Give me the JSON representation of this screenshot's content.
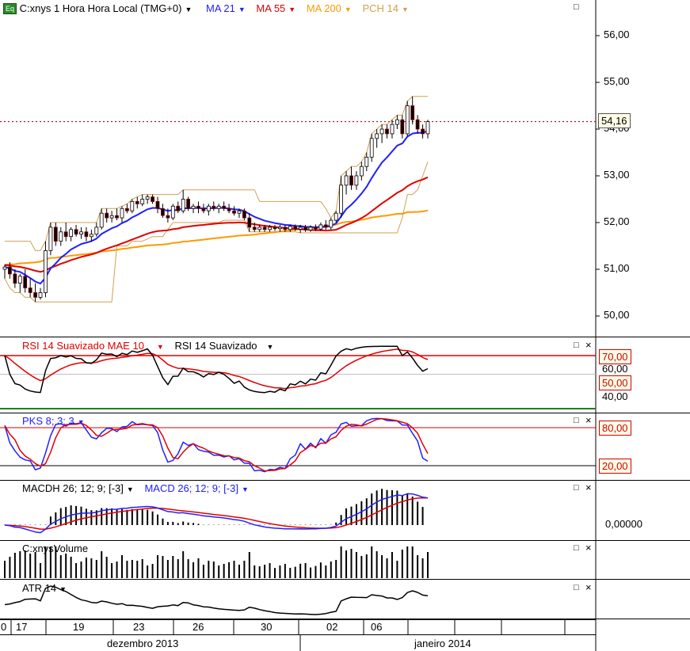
{
  "main": {
    "eq_icon": "Eq",
    "symbol": "C:xnys 1 Hora Hora Local (TMG+0)",
    "indicators": [
      {
        "label": "MA 21",
        "color": "#2020ff"
      },
      {
        "label": "MA 55",
        "color": "#e00000"
      },
      {
        "label": "MA 200",
        "color": "#ff9900"
      },
      {
        "label": "PCH 14",
        "color": "#d0a050"
      }
    ],
    "price_axis": [
      "56,00",
      "55,00",
      "54,00",
      "53,00",
      "52,00",
      "51,00",
      "50,00"
    ],
    "last_price": "54,16",
    "ohlc": [
      [
        51.0,
        51.1,
        50.8,
        51.05
      ],
      [
        51.05,
        51.15,
        50.8,
        50.9
      ],
      [
        50.9,
        51.0,
        50.6,
        50.7
      ],
      [
        50.7,
        50.9,
        50.5,
        50.85
      ],
      [
        50.85,
        51.0,
        50.5,
        50.6
      ],
      [
        50.6,
        50.8,
        50.4,
        50.5
      ],
      [
        50.5,
        50.7,
        50.3,
        50.4
      ],
      [
        50.4,
        50.6,
        50.35,
        50.5
      ],
      [
        50.5,
        51.6,
        50.4,
        51.4
      ],
      [
        51.4,
        52.0,
        51.3,
        51.9
      ],
      [
        51.9,
        52.0,
        51.5,
        51.6
      ],
      [
        51.6,
        51.9,
        51.5,
        51.8
      ],
      [
        51.8,
        52.0,
        51.6,
        51.7
      ],
      [
        51.7,
        51.9,
        51.6,
        51.85
      ],
      [
        51.85,
        51.95,
        51.7,
        51.75
      ],
      [
        51.75,
        51.9,
        51.65,
        51.8
      ],
      [
        51.8,
        51.9,
        51.6,
        51.7
      ],
      [
        51.7,
        51.85,
        51.6,
        51.75
      ],
      [
        51.75,
        52.0,
        51.7,
        51.9
      ],
      [
        51.9,
        52.3,
        51.85,
        52.2
      ],
      [
        52.2,
        52.3,
        52.0,
        52.1
      ],
      [
        52.1,
        52.25,
        52.0,
        52.15
      ],
      [
        52.15,
        52.3,
        52.05,
        52.1
      ],
      [
        52.1,
        52.35,
        52.0,
        52.3
      ],
      [
        52.3,
        52.4,
        52.2,
        52.25
      ],
      [
        52.25,
        52.5,
        52.2,
        52.45
      ],
      [
        52.45,
        52.55,
        52.3,
        52.4
      ],
      [
        52.4,
        52.6,
        52.35,
        52.5
      ],
      [
        52.5,
        52.6,
        52.4,
        52.55
      ],
      [
        52.55,
        52.6,
        52.4,
        52.45
      ],
      [
        52.45,
        52.55,
        52.2,
        52.3
      ],
      [
        52.3,
        52.4,
        52.1,
        52.15
      ],
      [
        52.15,
        52.3,
        52.0,
        52.1
      ],
      [
        52.1,
        52.4,
        52.05,
        52.35
      ],
      [
        52.35,
        52.45,
        52.2,
        52.25
      ],
      [
        52.25,
        52.7,
        52.2,
        52.5
      ],
      [
        52.5,
        52.55,
        52.25,
        52.3
      ],
      [
        52.3,
        52.4,
        52.2,
        52.35
      ],
      [
        52.35,
        52.45,
        52.2,
        52.3
      ],
      [
        52.3,
        52.4,
        52.2,
        52.25
      ],
      [
        52.25,
        52.4,
        52.15,
        52.35
      ],
      [
        52.35,
        52.45,
        52.25,
        52.3
      ],
      [
        52.3,
        52.4,
        52.2,
        52.35
      ],
      [
        52.35,
        52.45,
        52.25,
        52.3
      ],
      [
        52.3,
        52.4,
        52.2,
        52.25
      ],
      [
        52.25,
        52.35,
        52.15,
        52.2
      ],
      [
        52.2,
        52.3,
        52.1,
        52.25
      ],
      [
        52.25,
        52.3,
        52.05,
        52.1
      ],
      [
        52.1,
        52.2,
        51.8,
        51.9
      ],
      [
        51.9,
        52.0,
        51.8,
        51.85
      ],
      [
        51.85,
        51.95,
        51.8,
        51.9
      ],
      [
        51.9,
        51.95,
        51.8,
        51.85
      ],
      [
        51.85,
        51.95,
        51.8,
        51.9
      ],
      [
        51.9,
        51.95,
        51.82,
        51.87
      ],
      [
        51.87,
        51.95,
        51.8,
        51.9
      ],
      [
        51.9,
        51.95,
        51.8,
        51.85
      ],
      [
        51.85,
        51.95,
        51.8,
        51.92
      ],
      [
        51.92,
        51.96,
        51.82,
        51.86
      ],
      [
        51.86,
        51.95,
        51.78,
        51.9
      ],
      [
        51.9,
        51.95,
        51.8,
        51.84
      ],
      [
        51.84,
        51.94,
        51.8,
        51.9
      ],
      [
        51.9,
        51.96,
        51.82,
        51.86
      ],
      [
        51.86,
        52.0,
        51.82,
        51.95
      ],
      [
        51.95,
        52.05,
        51.85,
        51.9
      ],
      [
        51.9,
        52.1,
        51.85,
        52.05
      ],
      [
        52.05,
        52.25,
        52.0,
        52.2
      ],
      [
        52.2,
        53.0,
        52.1,
        52.8
      ],
      [
        52.8,
        53.1,
        52.6,
        53.0
      ],
      [
        53.0,
        53.2,
        52.7,
        52.8
      ],
      [
        52.8,
        53.1,
        52.7,
        53.0
      ],
      [
        53.0,
        53.3,
        52.9,
        53.2
      ],
      [
        53.2,
        53.5,
        53.1,
        53.4
      ],
      [
        53.4,
        53.9,
        53.3,
        53.8
      ],
      [
        53.8,
        54.0,
        53.6,
        53.9
      ],
      [
        53.9,
        54.1,
        53.7,
        54.0
      ],
      [
        54.0,
        54.1,
        53.8,
        53.9
      ],
      [
        53.9,
        54.2,
        53.8,
        54.1
      ],
      [
        54.1,
        54.3,
        54.0,
        54.2
      ],
      [
        54.2,
        54.3,
        53.8,
        53.9
      ],
      [
        53.9,
        54.6,
        53.85,
        54.5
      ],
      [
        54.5,
        54.7,
        54.1,
        54.2
      ],
      [
        54.2,
        54.3,
        53.9,
        54.0
      ],
      [
        54.0,
        54.1,
        53.8,
        53.9
      ],
      [
        53.9,
        54.2,
        53.8,
        54.16
      ]
    ],
    "pch_upper": [
      51.6,
      51.6,
      51.6,
      51.6,
      51.6,
      51.6,
      51.4,
      51.4,
      51.6,
      52.0,
      52.0,
      52.0,
      52.0,
      52.0,
      52.0,
      52.0,
      52.0,
      52.0,
      52.0,
      52.3,
      52.3,
      52.3,
      52.3,
      52.35,
      52.4,
      52.5,
      52.55,
      52.6,
      52.6,
      52.6,
      52.6,
      52.6,
      52.6,
      52.6,
      52.6,
      52.7,
      52.7,
      52.7,
      52.7,
      52.7,
      52.7,
      52.7,
      52.7,
      52.7,
      52.7,
      52.7,
      52.7,
      52.7,
      52.7,
      52.7,
      52.45,
      52.45,
      52.45,
      52.45,
      52.45,
      52.45,
      52.45,
      52.45,
      52.45,
      52.45,
      52.45,
      52.45,
      52.45,
      52.3,
      52.1,
      52.25,
      53.0,
      53.1,
      53.2,
      53.2,
      53.3,
      53.5,
      53.9,
      54.0,
      54.1,
      54.1,
      54.2,
      54.3,
      54.3,
      54.6,
      54.7,
      54.7,
      54.7,
      54.7
    ],
    "pch_lower": [
      50.8,
      50.6,
      50.5,
      50.5,
      50.4,
      50.4,
      50.3,
      50.3,
      50.3,
      50.3,
      50.3,
      50.3,
      50.3,
      50.3,
      50.3,
      50.3,
      50.3,
      50.3,
      50.3,
      50.3,
      50.3,
      50.3,
      51.5,
      51.5,
      51.5,
      51.6,
      51.6,
      51.6,
      51.65,
      51.7,
      51.7,
      51.7,
      51.85,
      52.0,
      52.0,
      52.0,
      52.0,
      52.0,
      52.0,
      52.0,
      52.0,
      52.0,
      52.0,
      52.05,
      52.05,
      52.05,
      52.05,
      52.05,
      51.8,
      51.8,
      51.8,
      51.8,
      51.8,
      51.8,
      51.8,
      51.8,
      51.8,
      51.8,
      51.78,
      51.78,
      51.78,
      51.78,
      51.78,
      51.78,
      51.78,
      51.78,
      51.78,
      51.78,
      51.78,
      51.78,
      51.78,
      51.78,
      51.78,
      51.78,
      51.78,
      51.78,
      51.78,
      51.78,
      52.1,
      52.6,
      52.6,
      52.7,
      53.0,
      53.3
    ]
  },
  "rsi": {
    "label_red": "RSI 14 Suavizado MAE 10",
    "label_black": "RSI 14 Suavizado",
    "level_70": "70,00",
    "level_60": "60,00",
    "level_50": "50,00",
    "level_40": "40,00"
  },
  "pks": {
    "label": "PKS 8; 3; 3",
    "level_80": "80,00",
    "level_20": "20,00"
  },
  "macd": {
    "label_black": "MACDH 26; 12; 9; [-3]",
    "label_blue": "MACD 26; 12; 9; [-3]",
    "zero": "0,00000"
  },
  "volume": {
    "label": "C:xnysVolume"
  },
  "atr": {
    "label": "ATR 14"
  },
  "xaxis": {
    "days": [
      "0",
      "17",
      "19",
      "23",
      "26",
      "30",
      "02",
      "06"
    ],
    "months": [
      "dezembro 2013",
      "janeiro 2014"
    ]
  }
}
